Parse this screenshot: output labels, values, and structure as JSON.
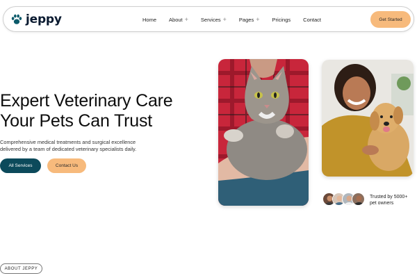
{
  "brand": {
    "name": "jeppy",
    "icon": "paw-icon",
    "color": "#0b5a6a"
  },
  "nav": {
    "items": [
      {
        "label": "Home",
        "has_submenu": false
      },
      {
        "label": "About",
        "has_submenu": true
      },
      {
        "label": "Services",
        "has_submenu": true
      },
      {
        "label": "Pages",
        "has_submenu": true
      },
      {
        "label": "Pricings",
        "has_submenu": false
      },
      {
        "label": "Contact",
        "has_submenu": false
      }
    ],
    "submenu_icon": "+",
    "cta_label": "Get Started"
  },
  "hero": {
    "title_line1": "Expert Veterinary Care",
    "title_line2": "Your Pets Can Trust",
    "subtitle_line1": "Comprehensive medical treatments and surgical excellence",
    "subtitle_line2": "delivered by a team of dedicated veterinary specialists daily.",
    "primary_button": "All Services",
    "secondary_button": "Contact Us"
  },
  "trusted": {
    "text_line1": "Trusted by 5000+",
    "text_line2": "pet owners"
  },
  "about_badge": "ABOUT JEPPY",
  "colors": {
    "primary": "#0c4a5b",
    "accent": "#f7ba7c",
    "text": "#0d0d0d"
  }
}
